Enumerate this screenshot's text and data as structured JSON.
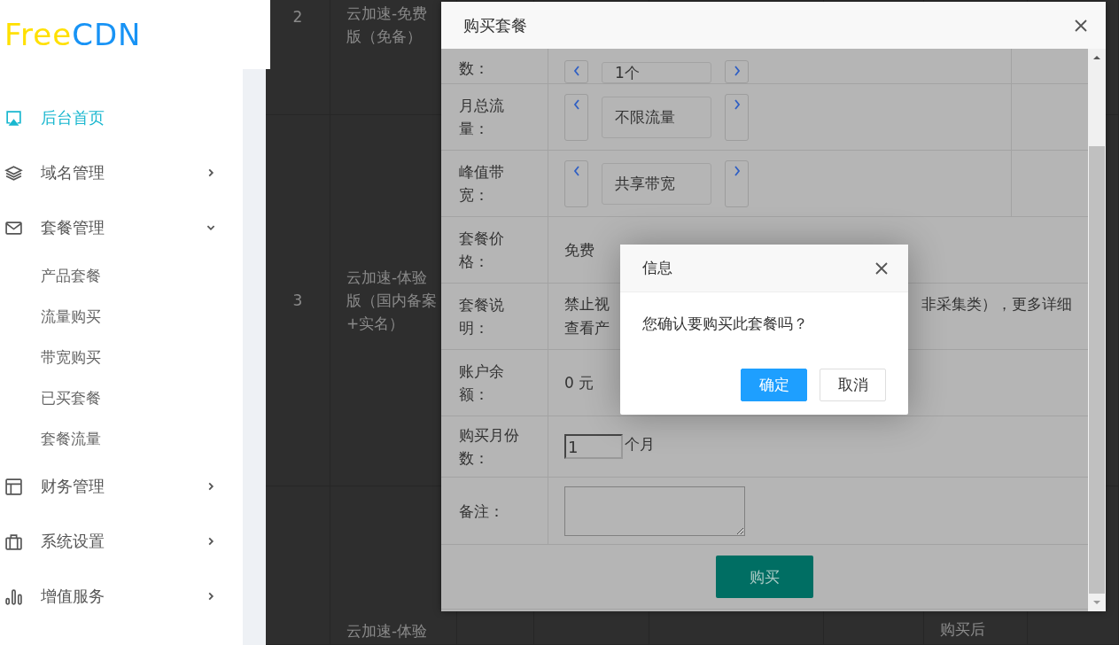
{
  "logo": {
    "part_1": "Free",
    "part_2": "CDN"
  },
  "sidebar": {
    "items": [
      {
        "label": "后台首页",
        "kind": "link",
        "selected": true
      },
      {
        "label": "域名管理",
        "kind": "group",
        "selected": false,
        "expanded": false
      },
      {
        "label": "套餐管理",
        "kind": "group",
        "selected": false,
        "expanded": true,
        "children": [
          {
            "label": "产品套餐",
            "selected": false
          },
          {
            "label": "流量购买",
            "selected": false
          },
          {
            "label": "带宽购买",
            "selected": false
          },
          {
            "label": "已买套餐",
            "selected": false
          },
          {
            "label": "套餐流量",
            "selected": false
          }
        ]
      },
      {
        "label": "财务管理",
        "kind": "group",
        "selected": false,
        "expanded": false
      },
      {
        "label": "系统设置",
        "kind": "group",
        "selected": false,
        "expanded": false
      },
      {
        "label": "增值服务",
        "kind": "group",
        "selected": false,
        "expanded": false
      }
    ]
  },
  "background_table": {
    "rows": [
      {
        "number": "2",
        "name": "云加速-免费版（免备）"
      },
      {
        "number": "3",
        "name": "云加速-体验版（国内备案+实名）"
      },
      {
        "name": "云加速-体验",
        "column_7": "购买后"
      }
    ]
  },
  "modal": {
    "title": "购买套餐",
    "rows": [
      {
        "label": "数：",
        "kind": "stepper",
        "value": "1个"
      },
      {
        "label": "月总流量：",
        "kind": "stepper",
        "value": "不限流量"
      },
      {
        "label": "峰值带宽：",
        "kind": "stepper",
        "value": "共享带宽"
      },
      {
        "label": "套餐价格：",
        "kind": "text",
        "value": "免费"
      },
      {
        "label": "套餐说明：",
        "kind": "description",
        "parts": [
          "禁止视",
          "非采集类），更多详细",
          "查看产"
        ]
      },
      {
        "label": "账户余额：",
        "kind": "text",
        "value": "0 元"
      },
      {
        "label": "购买月份数：",
        "kind": "number",
        "value": "1",
        "unit": "个月"
      },
      {
        "label": "备注：",
        "kind": "textarea"
      }
    ],
    "button": "购买"
  },
  "dialog": {
    "title": "信息",
    "message": "您确认要购买此套餐吗？",
    "buttons": [
      {
        "label": "确定",
        "primary": true
      },
      {
        "label": "取消",
        "primary": false
      }
    ]
  }
}
